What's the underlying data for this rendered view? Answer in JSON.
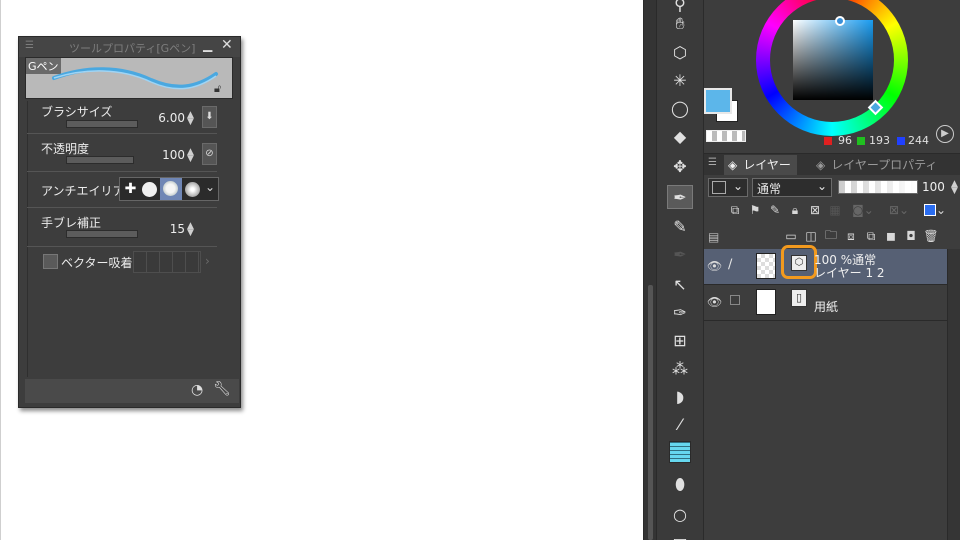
{
  "tool_property": {
    "title": "ツールプロパティ[Gペン]",
    "preview_label": "Gペン",
    "brush_size_label": "ブラシサイズ",
    "brush_size_value": "6.00",
    "opacity_label": "不透明度",
    "opacity_value": "100",
    "antialias_label": "アンチエイリアス",
    "stabilization_label": "手ブレ補正",
    "stabilization_value": "15",
    "vector_snap_label": "ベクター吸着"
  },
  "color": {
    "r": "96",
    "g": "193",
    "b": "244",
    "main_color": "#5cb6ea"
  },
  "layer_panel": {
    "tabs": [
      {
        "label": "レイヤー"
      },
      {
        "label": "レイヤープロパティ"
      }
    ],
    "blend_mode": "通常",
    "opacity": "100",
    "layers": [
      {
        "mode_line": "100 %通常",
        "name": "レイヤー 1 2",
        "selected": true
      },
      {
        "mode_line": "",
        "name": "用紙",
        "selected": false
      }
    ]
  },
  "accent_color": "#f39a1e"
}
